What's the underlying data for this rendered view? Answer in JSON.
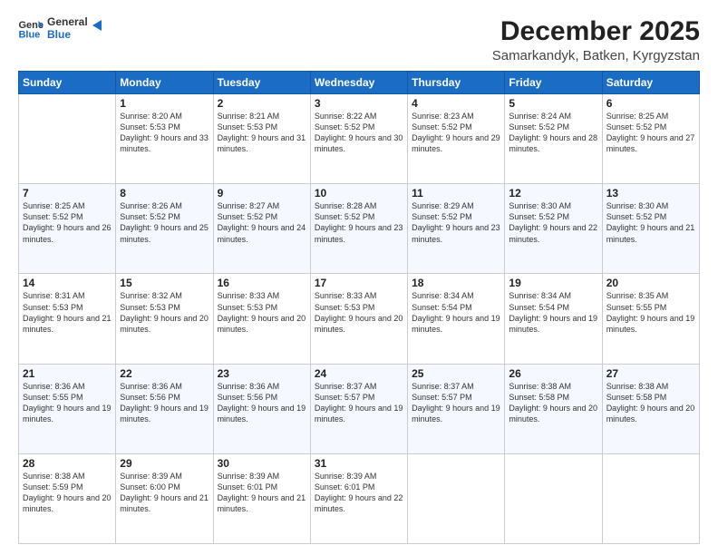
{
  "logo": {
    "line1": "General",
    "line2": "Blue"
  },
  "title": "December 2025",
  "subtitle": "Samarkandyk, Batken, Kyrgyzstan",
  "days_of_week": [
    "Sunday",
    "Monday",
    "Tuesday",
    "Wednesday",
    "Thursday",
    "Friday",
    "Saturday"
  ],
  "weeks": [
    [
      {
        "day": "",
        "sunrise": "",
        "sunset": "",
        "daylight": ""
      },
      {
        "day": "1",
        "sunrise": "Sunrise: 8:20 AM",
        "sunset": "Sunset: 5:53 PM",
        "daylight": "Daylight: 9 hours and 33 minutes."
      },
      {
        "day": "2",
        "sunrise": "Sunrise: 8:21 AM",
        "sunset": "Sunset: 5:53 PM",
        "daylight": "Daylight: 9 hours and 31 minutes."
      },
      {
        "day": "3",
        "sunrise": "Sunrise: 8:22 AM",
        "sunset": "Sunset: 5:52 PM",
        "daylight": "Daylight: 9 hours and 30 minutes."
      },
      {
        "day": "4",
        "sunrise": "Sunrise: 8:23 AM",
        "sunset": "Sunset: 5:52 PM",
        "daylight": "Daylight: 9 hours and 29 minutes."
      },
      {
        "day": "5",
        "sunrise": "Sunrise: 8:24 AM",
        "sunset": "Sunset: 5:52 PM",
        "daylight": "Daylight: 9 hours and 28 minutes."
      },
      {
        "day": "6",
        "sunrise": "Sunrise: 8:25 AM",
        "sunset": "Sunset: 5:52 PM",
        "daylight": "Daylight: 9 hours and 27 minutes."
      }
    ],
    [
      {
        "day": "7",
        "sunrise": "Sunrise: 8:25 AM",
        "sunset": "Sunset: 5:52 PM",
        "daylight": "Daylight: 9 hours and 26 minutes."
      },
      {
        "day": "8",
        "sunrise": "Sunrise: 8:26 AM",
        "sunset": "Sunset: 5:52 PM",
        "daylight": "Daylight: 9 hours and 25 minutes."
      },
      {
        "day": "9",
        "sunrise": "Sunrise: 8:27 AM",
        "sunset": "Sunset: 5:52 PM",
        "daylight": "Daylight: 9 hours and 24 minutes."
      },
      {
        "day": "10",
        "sunrise": "Sunrise: 8:28 AM",
        "sunset": "Sunset: 5:52 PM",
        "daylight": "Daylight: 9 hours and 23 minutes."
      },
      {
        "day": "11",
        "sunrise": "Sunrise: 8:29 AM",
        "sunset": "Sunset: 5:52 PM",
        "daylight": "Daylight: 9 hours and 23 minutes."
      },
      {
        "day": "12",
        "sunrise": "Sunrise: 8:30 AM",
        "sunset": "Sunset: 5:52 PM",
        "daylight": "Daylight: 9 hours and 22 minutes."
      },
      {
        "day": "13",
        "sunrise": "Sunrise: 8:30 AM",
        "sunset": "Sunset: 5:52 PM",
        "daylight": "Daylight: 9 hours and 21 minutes."
      }
    ],
    [
      {
        "day": "14",
        "sunrise": "Sunrise: 8:31 AM",
        "sunset": "Sunset: 5:53 PM",
        "daylight": "Daylight: 9 hours and 21 minutes."
      },
      {
        "day": "15",
        "sunrise": "Sunrise: 8:32 AM",
        "sunset": "Sunset: 5:53 PM",
        "daylight": "Daylight: 9 hours and 20 minutes."
      },
      {
        "day": "16",
        "sunrise": "Sunrise: 8:33 AM",
        "sunset": "Sunset: 5:53 PM",
        "daylight": "Daylight: 9 hours and 20 minutes."
      },
      {
        "day": "17",
        "sunrise": "Sunrise: 8:33 AM",
        "sunset": "Sunset: 5:53 PM",
        "daylight": "Daylight: 9 hours and 20 minutes."
      },
      {
        "day": "18",
        "sunrise": "Sunrise: 8:34 AM",
        "sunset": "Sunset: 5:54 PM",
        "daylight": "Daylight: 9 hours and 19 minutes."
      },
      {
        "day": "19",
        "sunrise": "Sunrise: 8:34 AM",
        "sunset": "Sunset: 5:54 PM",
        "daylight": "Daylight: 9 hours and 19 minutes."
      },
      {
        "day": "20",
        "sunrise": "Sunrise: 8:35 AM",
        "sunset": "Sunset: 5:55 PM",
        "daylight": "Daylight: 9 hours and 19 minutes."
      }
    ],
    [
      {
        "day": "21",
        "sunrise": "Sunrise: 8:36 AM",
        "sunset": "Sunset: 5:55 PM",
        "daylight": "Daylight: 9 hours and 19 minutes."
      },
      {
        "day": "22",
        "sunrise": "Sunrise: 8:36 AM",
        "sunset": "Sunset: 5:56 PM",
        "daylight": "Daylight: 9 hours and 19 minutes."
      },
      {
        "day": "23",
        "sunrise": "Sunrise: 8:36 AM",
        "sunset": "Sunset: 5:56 PM",
        "daylight": "Daylight: 9 hours and 19 minutes."
      },
      {
        "day": "24",
        "sunrise": "Sunrise: 8:37 AM",
        "sunset": "Sunset: 5:57 PM",
        "daylight": "Daylight: 9 hours and 19 minutes."
      },
      {
        "day": "25",
        "sunrise": "Sunrise: 8:37 AM",
        "sunset": "Sunset: 5:57 PM",
        "daylight": "Daylight: 9 hours and 19 minutes."
      },
      {
        "day": "26",
        "sunrise": "Sunrise: 8:38 AM",
        "sunset": "Sunset: 5:58 PM",
        "daylight": "Daylight: 9 hours and 20 minutes."
      },
      {
        "day": "27",
        "sunrise": "Sunrise: 8:38 AM",
        "sunset": "Sunset: 5:58 PM",
        "daylight": "Daylight: 9 hours and 20 minutes."
      }
    ],
    [
      {
        "day": "28",
        "sunrise": "Sunrise: 8:38 AM",
        "sunset": "Sunset: 5:59 PM",
        "daylight": "Daylight: 9 hours and 20 minutes."
      },
      {
        "day": "29",
        "sunrise": "Sunrise: 8:39 AM",
        "sunset": "Sunset: 6:00 PM",
        "daylight": "Daylight: 9 hours and 21 minutes."
      },
      {
        "day": "30",
        "sunrise": "Sunrise: 8:39 AM",
        "sunset": "Sunset: 6:01 PM",
        "daylight": "Daylight: 9 hours and 21 minutes."
      },
      {
        "day": "31",
        "sunrise": "Sunrise: 8:39 AM",
        "sunset": "Sunset: 6:01 PM",
        "daylight": "Daylight: 9 hours and 22 minutes."
      },
      {
        "day": "",
        "sunrise": "",
        "sunset": "",
        "daylight": ""
      },
      {
        "day": "",
        "sunrise": "",
        "sunset": "",
        "daylight": ""
      },
      {
        "day": "",
        "sunrise": "",
        "sunset": "",
        "daylight": ""
      }
    ]
  ]
}
